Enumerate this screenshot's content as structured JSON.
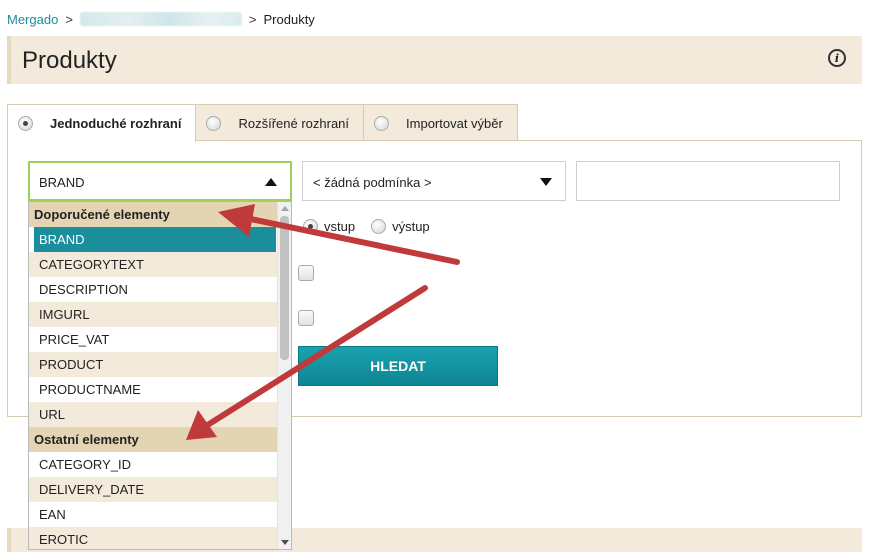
{
  "breadcrumb": {
    "root": "Mergado",
    "separator": ">",
    "current": "Produkty"
  },
  "page": {
    "title": "Produkty",
    "info_icon": "info-icon"
  },
  "tabs": [
    {
      "label": "Jednoduché rozhraní",
      "active": true
    },
    {
      "label": "Rozšířené rozhraní",
      "active": false
    },
    {
      "label": "Importovat výběr",
      "active": false
    }
  ],
  "filter": {
    "element_select_value": "BRAND",
    "condition_select_value": "< žádná podmínka >",
    "value_input": "",
    "io_options": [
      "vstup",
      "výstup"
    ],
    "io_selected": "vstup",
    "search_label": "HLEDAT"
  },
  "dropdown": {
    "group_recommended": "Doporučené elementy",
    "recommended": [
      "BRAND",
      "CATEGORYTEXT",
      "DESCRIPTION",
      "IMGURL",
      "PRICE_VAT",
      "PRODUCT",
      "PRODUCTNAME",
      "URL"
    ],
    "group_other": "Ostatní elementy",
    "other": [
      "CATEGORY_ID",
      "DELIVERY_DATE",
      "EAN",
      "EROTIC"
    ],
    "selected": "BRAND"
  },
  "colors": {
    "accent": "#1a8e9a",
    "header_bg": "#f3eadb",
    "group_bg": "#e3d5b3",
    "arrow": "#c0393b",
    "focus_border": "#9bd15a"
  }
}
